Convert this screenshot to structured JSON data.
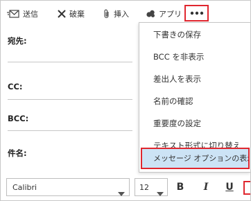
{
  "toolbar": {
    "send_label": "送信",
    "discard_label": "破棄",
    "insert_label": "挿入",
    "apps_label": "アプリ",
    "more_icon": "more-horizontal-icon"
  },
  "fields": {
    "to_label": "宛先:",
    "cc_label": "CC:",
    "bcc_label": "BCC:",
    "subject_label": "件名:"
  },
  "format": {
    "font_value": "Calibri",
    "size_value": "12",
    "bold": "B",
    "italic": "I",
    "underline": "U"
  },
  "menu": {
    "items": [
      "下書きの保存",
      "BCC を非表示",
      "差出人を表示",
      "名前の確認",
      "重要度の設定",
      "テキスト形式に切り替え",
      "メッセージ オプションの表示..."
    ]
  },
  "colors": {
    "highlight_border": "#e0262e",
    "selected_item_bg": "#cce3f5"
  }
}
